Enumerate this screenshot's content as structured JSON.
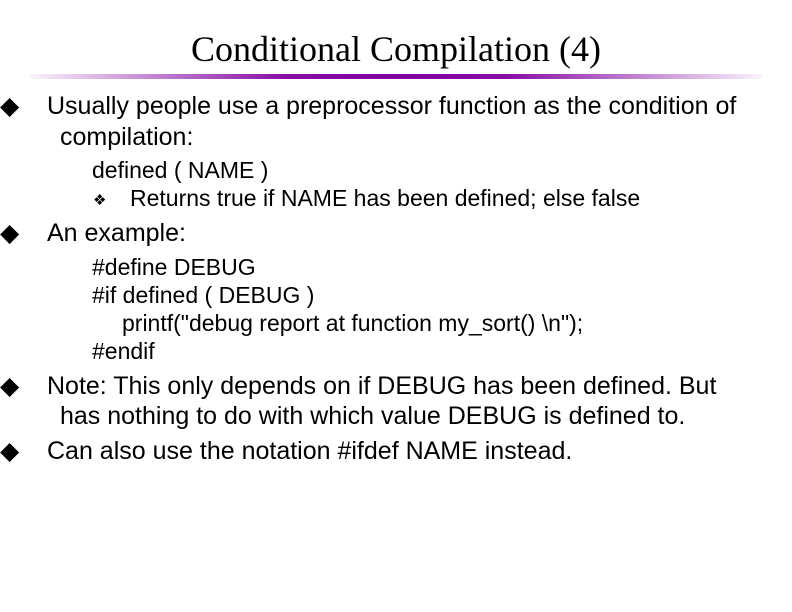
{
  "title": "Conditional Compilation (4)",
  "bullets": {
    "b1": "Usually people use a preprocessor function as the condition of compilation:",
    "b1_sub1": "defined ( NAME )",
    "b1_sub2": "Returns true if NAME has been defined; else false",
    "b2": "An example:",
    "b2_code1": "#define DEBUG",
    "b2_code2": "#if defined ( DEBUG )",
    "b2_code3": "printf(\"debug report at function my_sort() \\n\");",
    "b2_code4": "#endif",
    "b3": "Note:  This only depends on if DEBUG has been defined.  But has nothing to do with which value DEBUG is defined to.",
    "b4": "Can also use the notation #ifdef NAME instead."
  },
  "glyphs": {
    "diamond": "◆",
    "mini": "❖"
  }
}
